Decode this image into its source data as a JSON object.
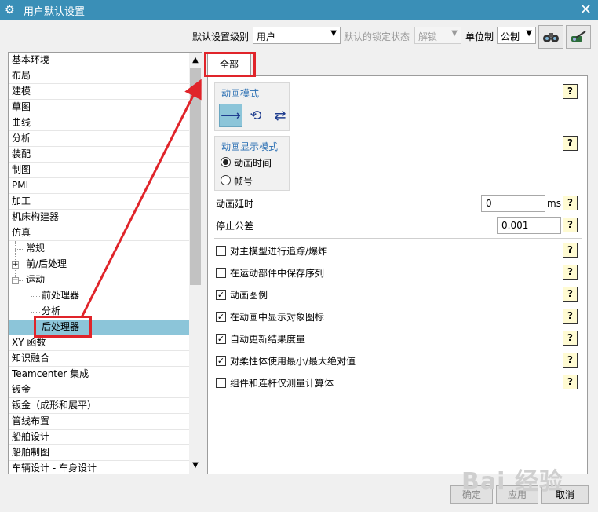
{
  "window": {
    "title": "用户默认设置",
    "close": "✕"
  },
  "toolbar": {
    "level_label": "默认设置级别",
    "level_value": "用户",
    "lock_label": "默认的锁定状态",
    "lock_value": "解锁",
    "unit_label": "单位制",
    "unit_value": "公制"
  },
  "tree": {
    "items": [
      "基本环境",
      "布局",
      "建模",
      "草图",
      "曲线",
      "分析",
      "装配",
      "制图",
      "PMI",
      "加工",
      "机床构建器",
      "仿真",
      "常规",
      "前/后处理",
      "运动",
      "前处理器",
      "分析",
      "后处理器",
      "XY 函数",
      "知识融合",
      "Teamcenter 集成",
      "钣金",
      "钣金（成形和展平）",
      "管线布置",
      "船舶设计",
      "船舶制图",
      "车辆设计 - 车身设计"
    ],
    "selected": "后处理器"
  },
  "tab": {
    "label": "全部"
  },
  "animation_mode": {
    "title": "动画模式"
  },
  "display_mode": {
    "title": "动画显示模式",
    "options": [
      "动画时间",
      "帧号"
    ],
    "selected": "动画时间"
  },
  "fields": {
    "delay_label": "动画延时",
    "delay_value": "0",
    "delay_unit": "ms",
    "tolerance_label": "停止公差",
    "tolerance_value": "0.001"
  },
  "checks": [
    {
      "label": "对主模型进行追踪/爆炸",
      "checked": false
    },
    {
      "label": "在运动部件中保存序列",
      "checked": false
    },
    {
      "label": "动画图例",
      "checked": true
    },
    {
      "label": "在动画中显示对象图标",
      "checked": true
    },
    {
      "label": "自动更新结果度量",
      "checked": true
    },
    {
      "label": "对柔性体使用最小/最大绝对值",
      "checked": true
    },
    {
      "label": "组件和连杆仅测量计算体",
      "checked": false
    }
  ],
  "help_glyph": "?",
  "buttons": {
    "ok": "确定",
    "apply": "应用",
    "cancel": "取消"
  },
  "watermark": "Bai 经验",
  "colors": {
    "titlebar": "#3a8fb7",
    "selected": "#8cc5d9",
    "highlight": "#e0242a",
    "group_title": "#2a6fb3"
  }
}
